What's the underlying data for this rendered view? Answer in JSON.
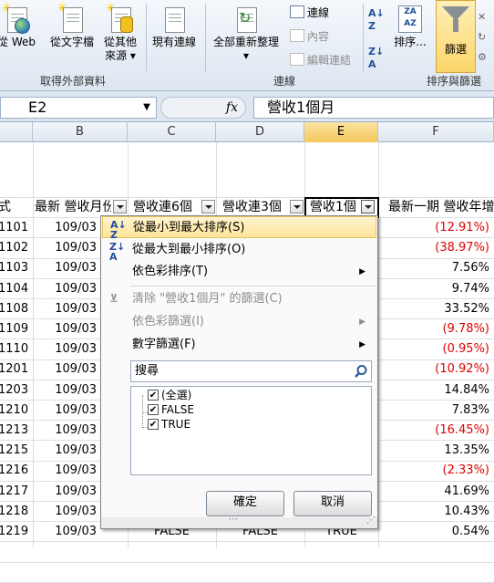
{
  "ribbon": {
    "buttons": {
      "from_web": {
        "line1": "從 Web",
        "line2": ""
      },
      "from_text": {
        "line1": "從文字檔",
        "line2": ""
      },
      "from_other": {
        "line1": "從其他",
        "line2": "來源"
      },
      "existing_conn": {
        "line1": "現有連線",
        "line2": ""
      },
      "refresh_all": {
        "line1": "全部重新整理",
        "line2": ""
      },
      "sort": "排序...",
      "filter": "篩選"
    },
    "connections_small": {
      "connections": "連線",
      "properties": "內容",
      "edit_links": "編輯連結"
    },
    "groups": {
      "get_external": "取得外部資料",
      "connections": "連線",
      "sort_filter": "排序與篩選"
    }
  },
  "formula_bar": {
    "name_box": "E2",
    "fx": "fx",
    "value": "營收1個月"
  },
  "columns": [
    "B",
    "C",
    "D",
    "E",
    "F"
  ],
  "header_row": {
    "col_a": "式",
    "col_b": "最新 營收月份",
    "col_c": "營收連6個",
    "col_d": "營收連3個",
    "col_e": "營收1個",
    "col_f": "最新一期 營收年增"
  },
  "rows": [
    {
      "a": "1101",
      "b": "109/03",
      "f": "(12.91%)",
      "neg": true
    },
    {
      "a": "1102",
      "b": "109/03",
      "f": "(38.97%)",
      "neg": true
    },
    {
      "a": "1103",
      "b": "109/03",
      "f": "7.56%",
      "neg": false
    },
    {
      "a": "1104",
      "b": "109/03",
      "f": "9.74%",
      "neg": false
    },
    {
      "a": "1108",
      "b": "109/03",
      "f": "33.52%",
      "neg": false
    },
    {
      "a": "1109",
      "b": "109/03",
      "f": "(9.78%)",
      "neg": true
    },
    {
      "a": "1110",
      "b": "109/03",
      "f": "(0.95%)",
      "neg": true
    },
    {
      "a": "1201",
      "b": "109/03",
      "f": "(10.92%)",
      "neg": true
    },
    {
      "a": "1203",
      "b": "109/03",
      "f": "14.84%",
      "neg": false
    },
    {
      "a": "1210",
      "b": "109/03",
      "f": "7.83%",
      "neg": false
    },
    {
      "a": "1213",
      "b": "109/03",
      "f": "(16.45%)",
      "neg": true
    },
    {
      "a": "1215",
      "b": "109/03",
      "f": "13.35%",
      "neg": false
    },
    {
      "a": "1216",
      "b": "109/03",
      "f": "(2.33%)",
      "neg": true
    },
    {
      "a": "1217",
      "b": "109/03",
      "f": "41.69%",
      "neg": false
    },
    {
      "a": "1218",
      "b": "109/03",
      "f": "10.43%",
      "neg": false
    },
    {
      "a": "1219",
      "b": "109/03",
      "c": "FALSE",
      "d": "FALSE",
      "e": "TRUE",
      "f": "0.54%",
      "neg": false
    }
  ],
  "filter_menu": {
    "sort_asc": "從最小到最大排序(S)",
    "sort_desc": "從最大到最小排序(O)",
    "sort_color": "依色彩排序(T)",
    "clear_filter": "清除 \"營收1個月\" 的篩選(C)",
    "filter_color": "依色彩篩選(I)",
    "number_filters": "數字篩選(F)",
    "search_placeholder": "搜尋",
    "options": [
      {
        "label": "(全選)",
        "checked": true
      },
      {
        "label": "FALSE",
        "checked": true
      },
      {
        "label": "TRUE",
        "checked": true
      }
    ],
    "ok": "確定",
    "cancel": "取消"
  }
}
